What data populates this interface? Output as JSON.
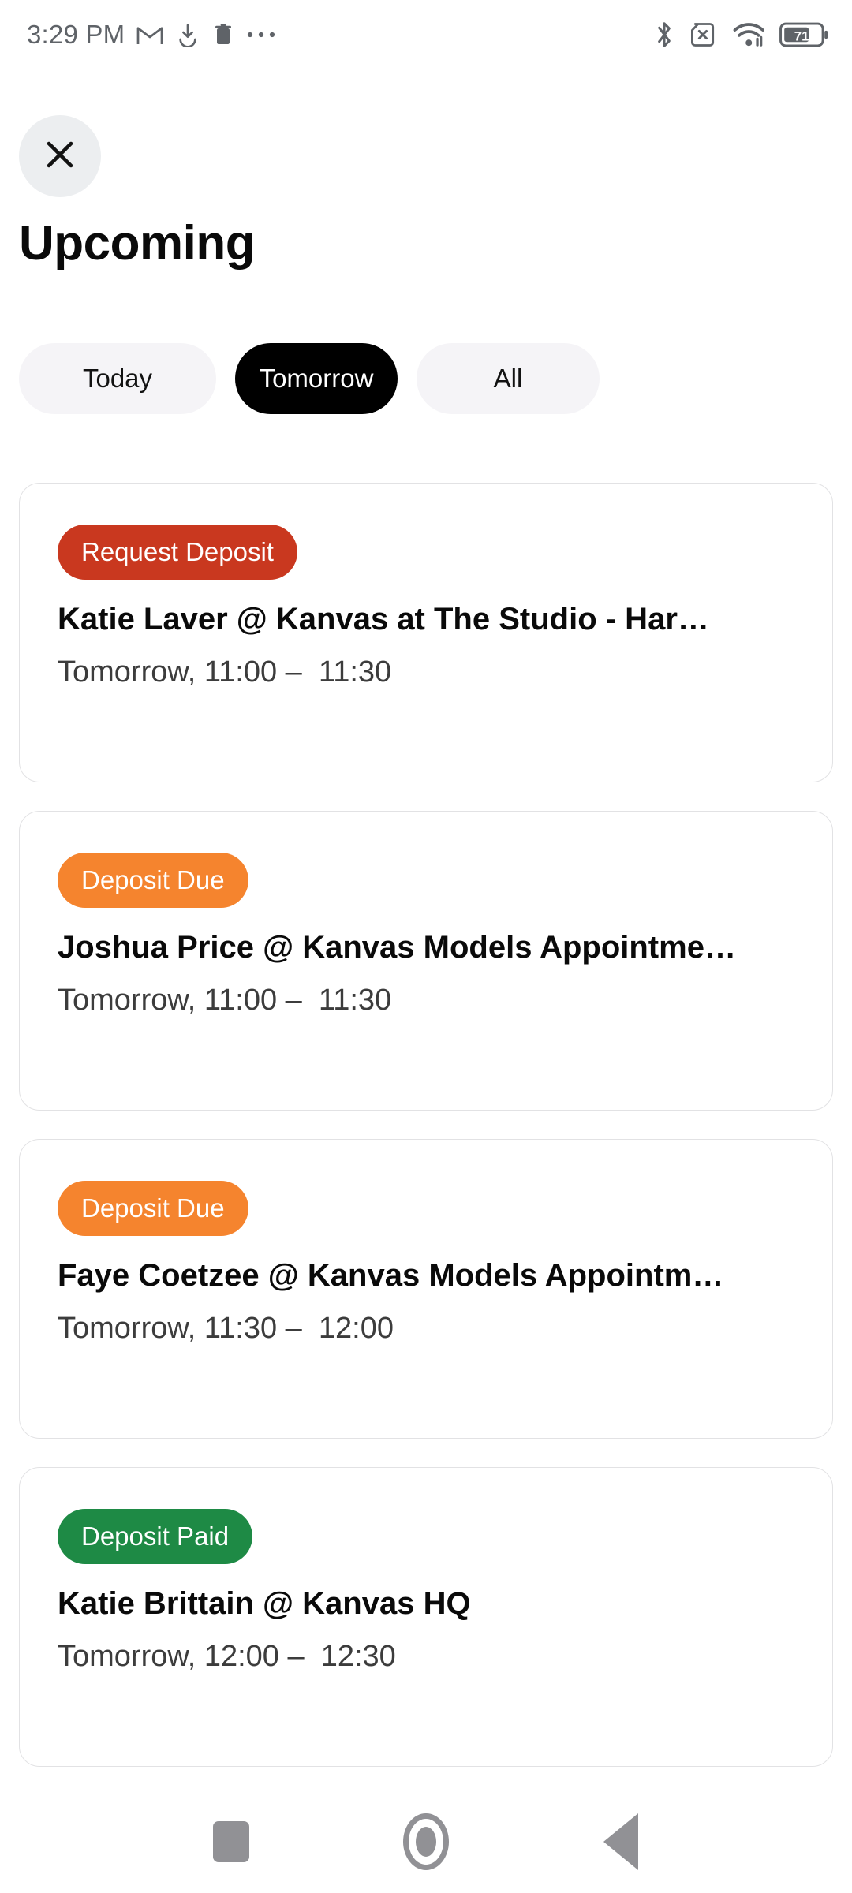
{
  "status_bar": {
    "time": "3:29 PM",
    "battery_level": "71",
    "left_icons": [
      "gmail-icon",
      "download-icon",
      "trash-icon",
      "overflow-menu-icon"
    ],
    "right_icons": [
      "bluetooth-icon",
      "sim-card-disabled-icon",
      "wifi-icon",
      "battery-icon"
    ]
  },
  "header": {
    "close_icon": "close-icon",
    "title": "Upcoming"
  },
  "tabs": [
    {
      "label": "Today",
      "active": false
    },
    {
      "label": "Tomorrow",
      "active": true
    },
    {
      "label": "All",
      "active": false
    }
  ],
  "colors": {
    "badge_request_deposit": "#c9381f",
    "badge_deposit_due": "#f5842e",
    "badge_deposit_paid": "#1e8a45",
    "tab_active_bg": "#000000",
    "tab_inactive_bg": "#f5f4f7",
    "card_border": "#e2e2e4",
    "nav_icon": "#919195"
  },
  "cards": [
    {
      "badge": "Request Deposit",
      "badge_color": "#c9381f",
      "title": "Katie  Laver @ Kanvas at The Studio - Har…",
      "time": "Tomorrow, 11:00 –  11:30"
    },
    {
      "badge": "Deposit Due",
      "badge_color": "#f5842e",
      "title": "Joshua Price @ Kanvas Models Appointme…",
      "time": "Tomorrow, 11:00 –  11:30"
    },
    {
      "badge": "Deposit Due",
      "badge_color": "#f5842e",
      "title": "Faye  Coetzee @ Kanvas Models Appointm…",
      "time": "Tomorrow, 11:30 –  12:00"
    },
    {
      "badge": "Deposit Paid",
      "badge_color": "#1e8a45",
      "title": "Katie Brittain @ Kanvas HQ",
      "time": "Tomorrow, 12:00 –  12:30"
    }
  ],
  "navbar": {
    "recents_icon": "square-recents-icon",
    "home_icon": "circle-home-icon",
    "back_icon": "triangle-back-icon"
  }
}
